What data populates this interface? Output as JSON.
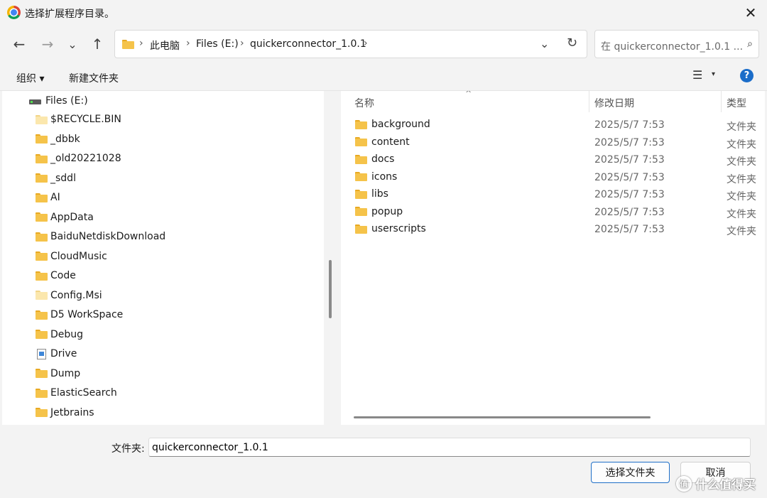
{
  "window": {
    "title": "选择扩展程序目录。",
    "close_glyph": "✕"
  },
  "nav": {
    "back": "←",
    "forward": "→",
    "recent": "⌄",
    "up": "↑"
  },
  "address": {
    "breadcrumbs": [
      "此电脑",
      "Files (E:)",
      "quickerconnector_1.0.1"
    ],
    "separator": "›",
    "dropdown_glyph": "⌄",
    "refresh_glyph": "↻"
  },
  "search": {
    "placeholder": "在 quickerconnector_1.0.1 ...",
    "icon": "⌕"
  },
  "toolbar": {
    "organize": "组织 ▾",
    "new_folder": "新建文件夹",
    "view_glyph": "☰",
    "view_dd": "▾",
    "help": "?"
  },
  "tree": {
    "drive": "Files (E:)",
    "items": [
      {
        "label": "$RECYCLE.BIN",
        "icon": "folder-pale"
      },
      {
        "label": "_dbbk",
        "icon": "folder"
      },
      {
        "label": "_old20221028",
        "icon": "folder"
      },
      {
        "label": "_sddl",
        "icon": "folder"
      },
      {
        "label": "AI",
        "icon": "folder"
      },
      {
        "label": "AppData",
        "icon": "folder"
      },
      {
        "label": "BaiduNetdiskDownload",
        "icon": "folder"
      },
      {
        "label": "CloudMusic",
        "icon": "folder"
      },
      {
        "label": "Code",
        "icon": "folder"
      },
      {
        "label": "Config.Msi",
        "icon": "folder-pale"
      },
      {
        "label": "D5 WorkSpace",
        "icon": "folder"
      },
      {
        "label": "Debug",
        "icon": "folder"
      },
      {
        "label": "Drive",
        "icon": "document"
      },
      {
        "label": "Dump",
        "icon": "folder"
      },
      {
        "label": "ElasticSearch",
        "icon": "folder"
      },
      {
        "label": "Jetbrains",
        "icon": "folder"
      }
    ]
  },
  "files": {
    "columns": {
      "name": "名称",
      "date": "修改日期",
      "type": "类型",
      "sort_glyph": "^"
    },
    "rows": [
      {
        "name": "background",
        "date": "2025/5/7 7:53",
        "type": "文件夹"
      },
      {
        "name": "content",
        "date": "2025/5/7 7:53",
        "type": "文件夹"
      },
      {
        "name": "docs",
        "date": "2025/5/7 7:53",
        "type": "文件夹"
      },
      {
        "name": "icons",
        "date": "2025/5/7 7:53",
        "type": "文件夹"
      },
      {
        "name": "libs",
        "date": "2025/5/7 7:53",
        "type": "文件夹"
      },
      {
        "name": "popup",
        "date": "2025/5/7 7:53",
        "type": "文件夹"
      },
      {
        "name": "userscripts",
        "date": "2025/5/7 7:53",
        "type": "文件夹"
      }
    ]
  },
  "footer": {
    "folder_label": "文件夹:",
    "folder_value": "quickerconnector_1.0.1",
    "select_button": "选择文件夹",
    "cancel_button": "取消"
  },
  "watermark": {
    "logo": "值",
    "text": "什么值得买"
  }
}
